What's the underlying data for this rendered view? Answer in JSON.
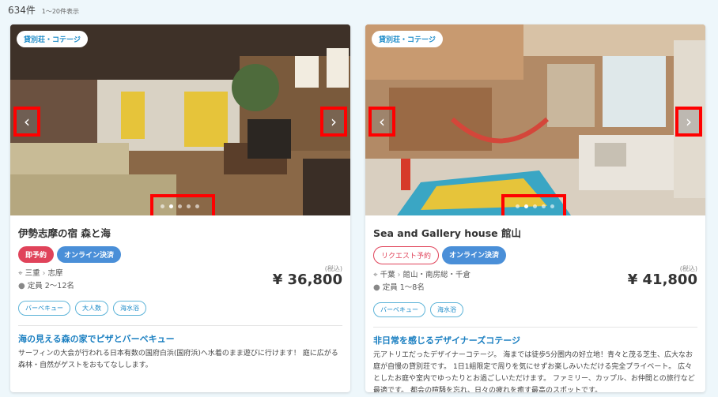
{
  "results": {
    "count": "634件",
    "range": "1〜20件表示"
  },
  "cards": [
    {
      "type_badge": "貸別荘・コテージ",
      "title": "伊勢志摩の宿 森と海",
      "badges": [
        "即予約",
        "オンライン決済"
      ],
      "location_pref": "三重",
      "location_area": "志摩",
      "capacity": "定員 2〜12名",
      "tax_label": "(税込)",
      "price": "¥ 36,800",
      "tags": [
        "バーベキュー",
        "大人数",
        "海水浴"
      ],
      "headline": "海の見える森の家でピザとバーベキュー",
      "description": "サーフィンの大会が行われる日本有数の国府白浜(国府浜)へ水着のまま遊びに行けます！ 庭に広がる森林・自然がゲストをおもてなしします。",
      "photo_index": 2
    },
    {
      "type_badge": "貸別荘・コテージ",
      "title": "Sea and Gallery house 館山",
      "badges": [
        "リクエスト予約",
        "オンライン決済"
      ],
      "location_pref": "千葉",
      "location_area": "館山・南房総・千倉",
      "capacity": "定員 1〜8名",
      "tax_label": "(税込)",
      "price": "¥ 41,800",
      "tags": [
        "バーベキュー",
        "海水浴"
      ],
      "headline": "非日常を感じるデザイナーズコテージ",
      "description": "元アトリエだったデザイナーコテージ。 海までは徒歩5分圏内の好立地！青々と茂る芝生、広大なお庭が自慢の貸別荘です。 1日1組限定で周りを気にせずお楽しみいただける完全プライベート。 広々としたお庭や室内でゆったりとお過ごしいただけます。 ファミリー、カップル、お仲間との旅行など最適です。 都会の喧騒を忘れ、日々の疲れを癒す最高のスポットです。",
      "photo_index": 2
    }
  ],
  "icons": {
    "prev": "chevron-left-icon",
    "next": "chevron-right-icon",
    "location": "pin-icon",
    "capacity": "person-icon"
  },
  "colors": {
    "accent_blue": "#1a8ac8",
    "instant_red": "#e0435a",
    "online_blue": "#4a8fd8",
    "highlight_red": "#ff0000"
  }
}
